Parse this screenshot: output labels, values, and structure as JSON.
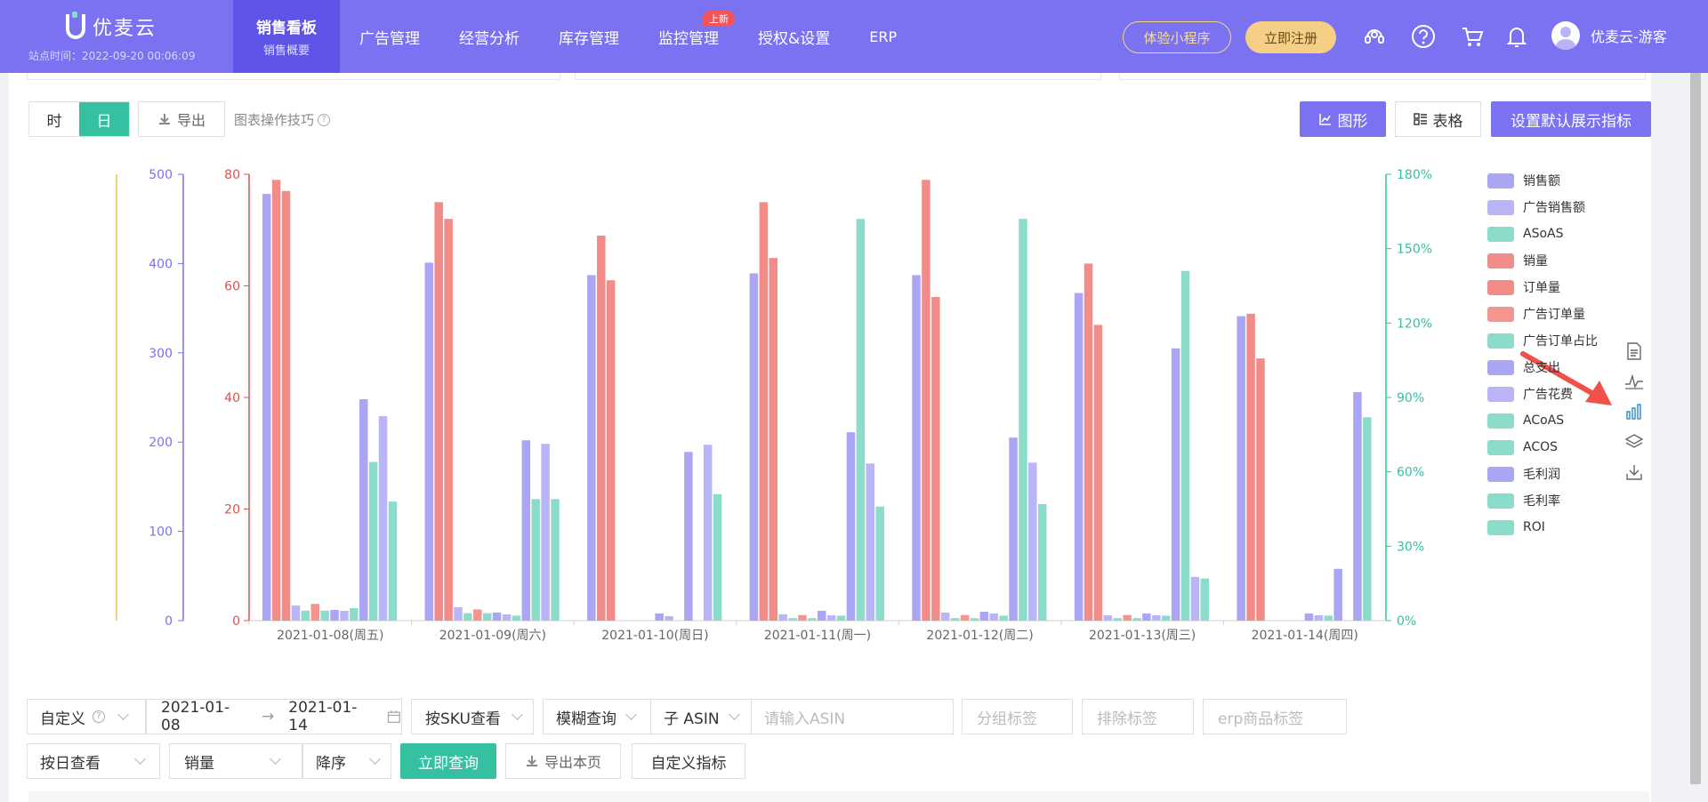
{
  "header": {
    "logo_text": "优麦云",
    "site_time": "站点时间：2022-09-20 00:06:09",
    "nav": [
      {
        "label": "销售看板",
        "sub": "销售概要",
        "active": true
      },
      {
        "label": "广告管理"
      },
      {
        "label": "经营分析"
      },
      {
        "label": "库存管理"
      },
      {
        "label": "监控管理",
        "badge": "上新"
      },
      {
        "label": "授权&设置"
      },
      {
        "label": "ERP"
      }
    ],
    "mini_program_button": "体验小程序",
    "register_button": "立即注册",
    "icons": [
      "headset-icon",
      "help-icon",
      "cart-icon",
      "bell-icon"
    ],
    "username": "优麦云-游客"
  },
  "toolbar": {
    "granularity": [
      "时",
      "日"
    ],
    "granularity_selected": "日",
    "export_label": "导出",
    "tips_label": "图表操作技巧",
    "graph_button": "图形",
    "table_button": "表格",
    "set_default_button": "设置默认展示指标"
  },
  "colors": {
    "purple": "#aba6f4",
    "purple_light": "#b9b5f7",
    "red": "#f28c88",
    "teal": "#8cdccb",
    "axis_purple": "#7a72f0",
    "axis_red": "#d9534f",
    "axis_teal": "#35c0a2",
    "axis_orange": "#f5c04a",
    "accent_teal": "#35c0a2",
    "accent_purple": "#7a72f0"
  },
  "chart_data": {
    "type": "bar",
    "categories": [
      "2021-01-08(周五)",
      "2021-01-09(周六)",
      "2021-01-10(周日)",
      "2021-01-11(周一)",
      "2021-01-12(周二)",
      "2021-01-13(周三)",
      "2021-01-14(周四)"
    ],
    "axes": {
      "left_outer": {
        "range": [
          0,
          500
        ],
        "ticks": [
          "0",
          "100",
          "200",
          "300",
          "400",
          "500"
        ]
      },
      "left_inner": {
        "range": [
          0,
          80
        ],
        "ticks": [
          "0",
          "20",
          "40",
          "60",
          "80"
        ]
      },
      "right": {
        "range": [
          0,
          180
        ],
        "ticks": [
          "0%",
          "30%",
          "60%",
          "90%",
          "120%",
          "150%",
          "180%"
        ]
      }
    },
    "legend": [
      {
        "name": "销售额",
        "color": "#aba6f4"
      },
      {
        "name": "广告销售额",
        "color": "#b9b5f7"
      },
      {
        "name": "ASoAS",
        "color": "#8cdccb"
      },
      {
        "name": "销量",
        "color": "#f28c88"
      },
      {
        "name": "订单量",
        "color": "#f28c88"
      },
      {
        "name": "广告订单量",
        "color": "#f4958f"
      },
      {
        "name": "广告订单占比",
        "color": "#8cdccb"
      },
      {
        "name": "总支出",
        "color": "#aba6f4"
      },
      {
        "name": "广告花费",
        "color": "#b9b5f7"
      },
      {
        "name": "ACoAS",
        "color": "#8cdccb"
      },
      {
        "name": "ACOS",
        "color": "#8cdccb"
      },
      {
        "name": "毛利润",
        "color": "#aba6f4"
      },
      {
        "name": "毛利率",
        "color": "#8cdccb"
      },
      {
        "name": "ROI",
        "color": "#8cdccb"
      }
    ],
    "series": [
      {
        "name": "销售额",
        "axis": "left_outer",
        "values": [
          478,
          401,
          387,
          389,
          387,
          367,
          341
        ]
      },
      {
        "name": "销量",
        "axis": "left_inner",
        "values": [
          79,
          75,
          69,
          75,
          79,
          64,
          55
        ]
      },
      {
        "name": "订单量",
        "axis": "left_inner",
        "values": [
          77,
          72,
          61,
          65,
          58,
          53,
          47
        ]
      },
      {
        "name": "广告销售额",
        "axis": "left_outer",
        "values": [
          17,
          15,
          0,
          7,
          9,
          6,
          0
        ]
      },
      {
        "name": "ASoAS",
        "axis": "right",
        "values": [
          4,
          3,
          0,
          1,
          1,
          1,
          0
        ]
      },
      {
        "name": "广告订单量",
        "axis": "left_inner",
        "values": [
          3,
          2,
          0,
          1,
          1,
          1,
          0
        ]
      },
      {
        "name": "广告订单占比",
        "axis": "right",
        "values": [
          4,
          3,
          0,
          1,
          1,
          1,
          0
        ]
      },
      {
        "name": "总支出",
        "axis": "left_outer",
        "values": [
          12,
          9,
          8,
          11,
          10,
          8,
          8
        ]
      },
      {
        "name": "广告花费",
        "axis": "left_outer",
        "values": [
          11,
          7,
          5,
          6,
          8,
          6,
          6
        ]
      },
      {
        "name": "ACoAS",
        "axis": "right",
        "values": [
          5,
          2,
          0,
          2,
          2,
          2,
          2
        ]
      },
      {
        "name": "毛利润",
        "axis": "left_outer",
        "values": [
          248,
          202,
          189,
          211,
          205,
          305,
          58
        ]
      },
      {
        "name": "毛利率",
        "axis": "left_outer",
        "values": [
          229,
          198,
          197,
          176,
          177,
          49,
          0
        ]
      },
      {
        "name": "ACOS",
        "axis": "right",
        "values": [
          64,
          49,
          0,
          162,
          162,
          141,
          0
        ]
      },
      {
        "name": "ROI",
        "axis": "right",
        "values": [
          48,
          49,
          51,
          46,
          47,
          17,
          82
        ]
      },
      {
        "name": "毛利率(右)",
        "axis": "left_outer",
        "values": [
          0,
          0,
          0,
          0,
          0,
          0,
          256
        ]
      }
    ]
  },
  "filters": {
    "range_type": "自定义",
    "date_start": "2021-01-08",
    "date_end": "2021-01-14",
    "view_by_sku": "按SKU查看",
    "fuzzy_query": "模糊查询",
    "asin_type": "子 ASIN",
    "asin_placeholder": "请输入ASIN",
    "group_tag_placeholder": "分组标签",
    "exclude_tag_placeholder": "排除标签",
    "erp_tag_placeholder": "erp商品标签",
    "view_by_day": "按日查看",
    "sort_field": "销量",
    "sort_order": "降序",
    "query_button": "立即查询",
    "export_page_button": "导出本页",
    "custom_metrics_button": "自定义指标"
  }
}
